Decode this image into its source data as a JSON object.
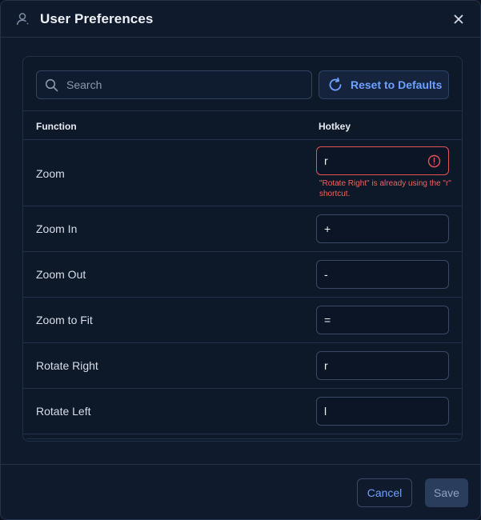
{
  "dialog": {
    "title": "User Preferences",
    "close_label": "×"
  },
  "toolbar": {
    "search_placeholder": "Search",
    "search_value": "",
    "reset_label": "Reset to Defaults"
  },
  "table": {
    "headers": [
      "Function",
      "Hotkey"
    ],
    "rows": [
      {
        "function": "Zoom",
        "hotkey": "r",
        "error": "\"Rotate Right\" is already using the \"r\" shortcut."
      },
      {
        "function": "Zoom In",
        "hotkey": "+"
      },
      {
        "function": "Zoom Out",
        "hotkey": "-"
      },
      {
        "function": "Zoom to Fit",
        "hotkey": "="
      },
      {
        "function": "Rotate Right",
        "hotkey": "r"
      },
      {
        "function": "Rotate Left",
        "hotkey": "l"
      }
    ]
  },
  "footer": {
    "cancel_label": "Cancel",
    "save_label": "Save"
  },
  "colors": {
    "accent": "#6ea0ff",
    "error": "#e25555",
    "background": "#0f1a2c"
  },
  "icons": {
    "header": "user-icon",
    "close": "close-icon",
    "search": "search-icon",
    "reset": "refresh-icon",
    "error": "alert-circle-icon"
  }
}
